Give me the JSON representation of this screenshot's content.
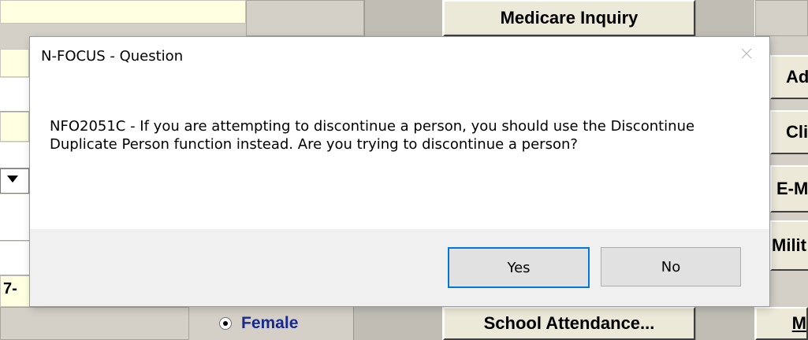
{
  "background": {
    "medicare_button": "Medicare Inquiry",
    "right_buttons": [
      "Ad",
      "Cli",
      "E-M",
      "Milit",
      "M"
    ],
    "field_fragment": "7-",
    "gender_option": "Female",
    "school_button": "School Attendance..."
  },
  "dialog": {
    "title": "N-FOCUS - Question",
    "message": "NFO2051C - If you are attempting to discontinue a person, you should use the Discontinue Duplicate Person function instead.  Are you trying to discontinue a person?",
    "yes_label": "Yes",
    "no_label": "No",
    "close_icon": "close-icon"
  },
  "colors": {
    "form_background": "#d4d0c8",
    "field_yellow": "#ffffe1",
    "label_blue": "#1a2a8a",
    "dialog_footer": "#f0f0f0",
    "focus_blue": "#0078d7"
  }
}
